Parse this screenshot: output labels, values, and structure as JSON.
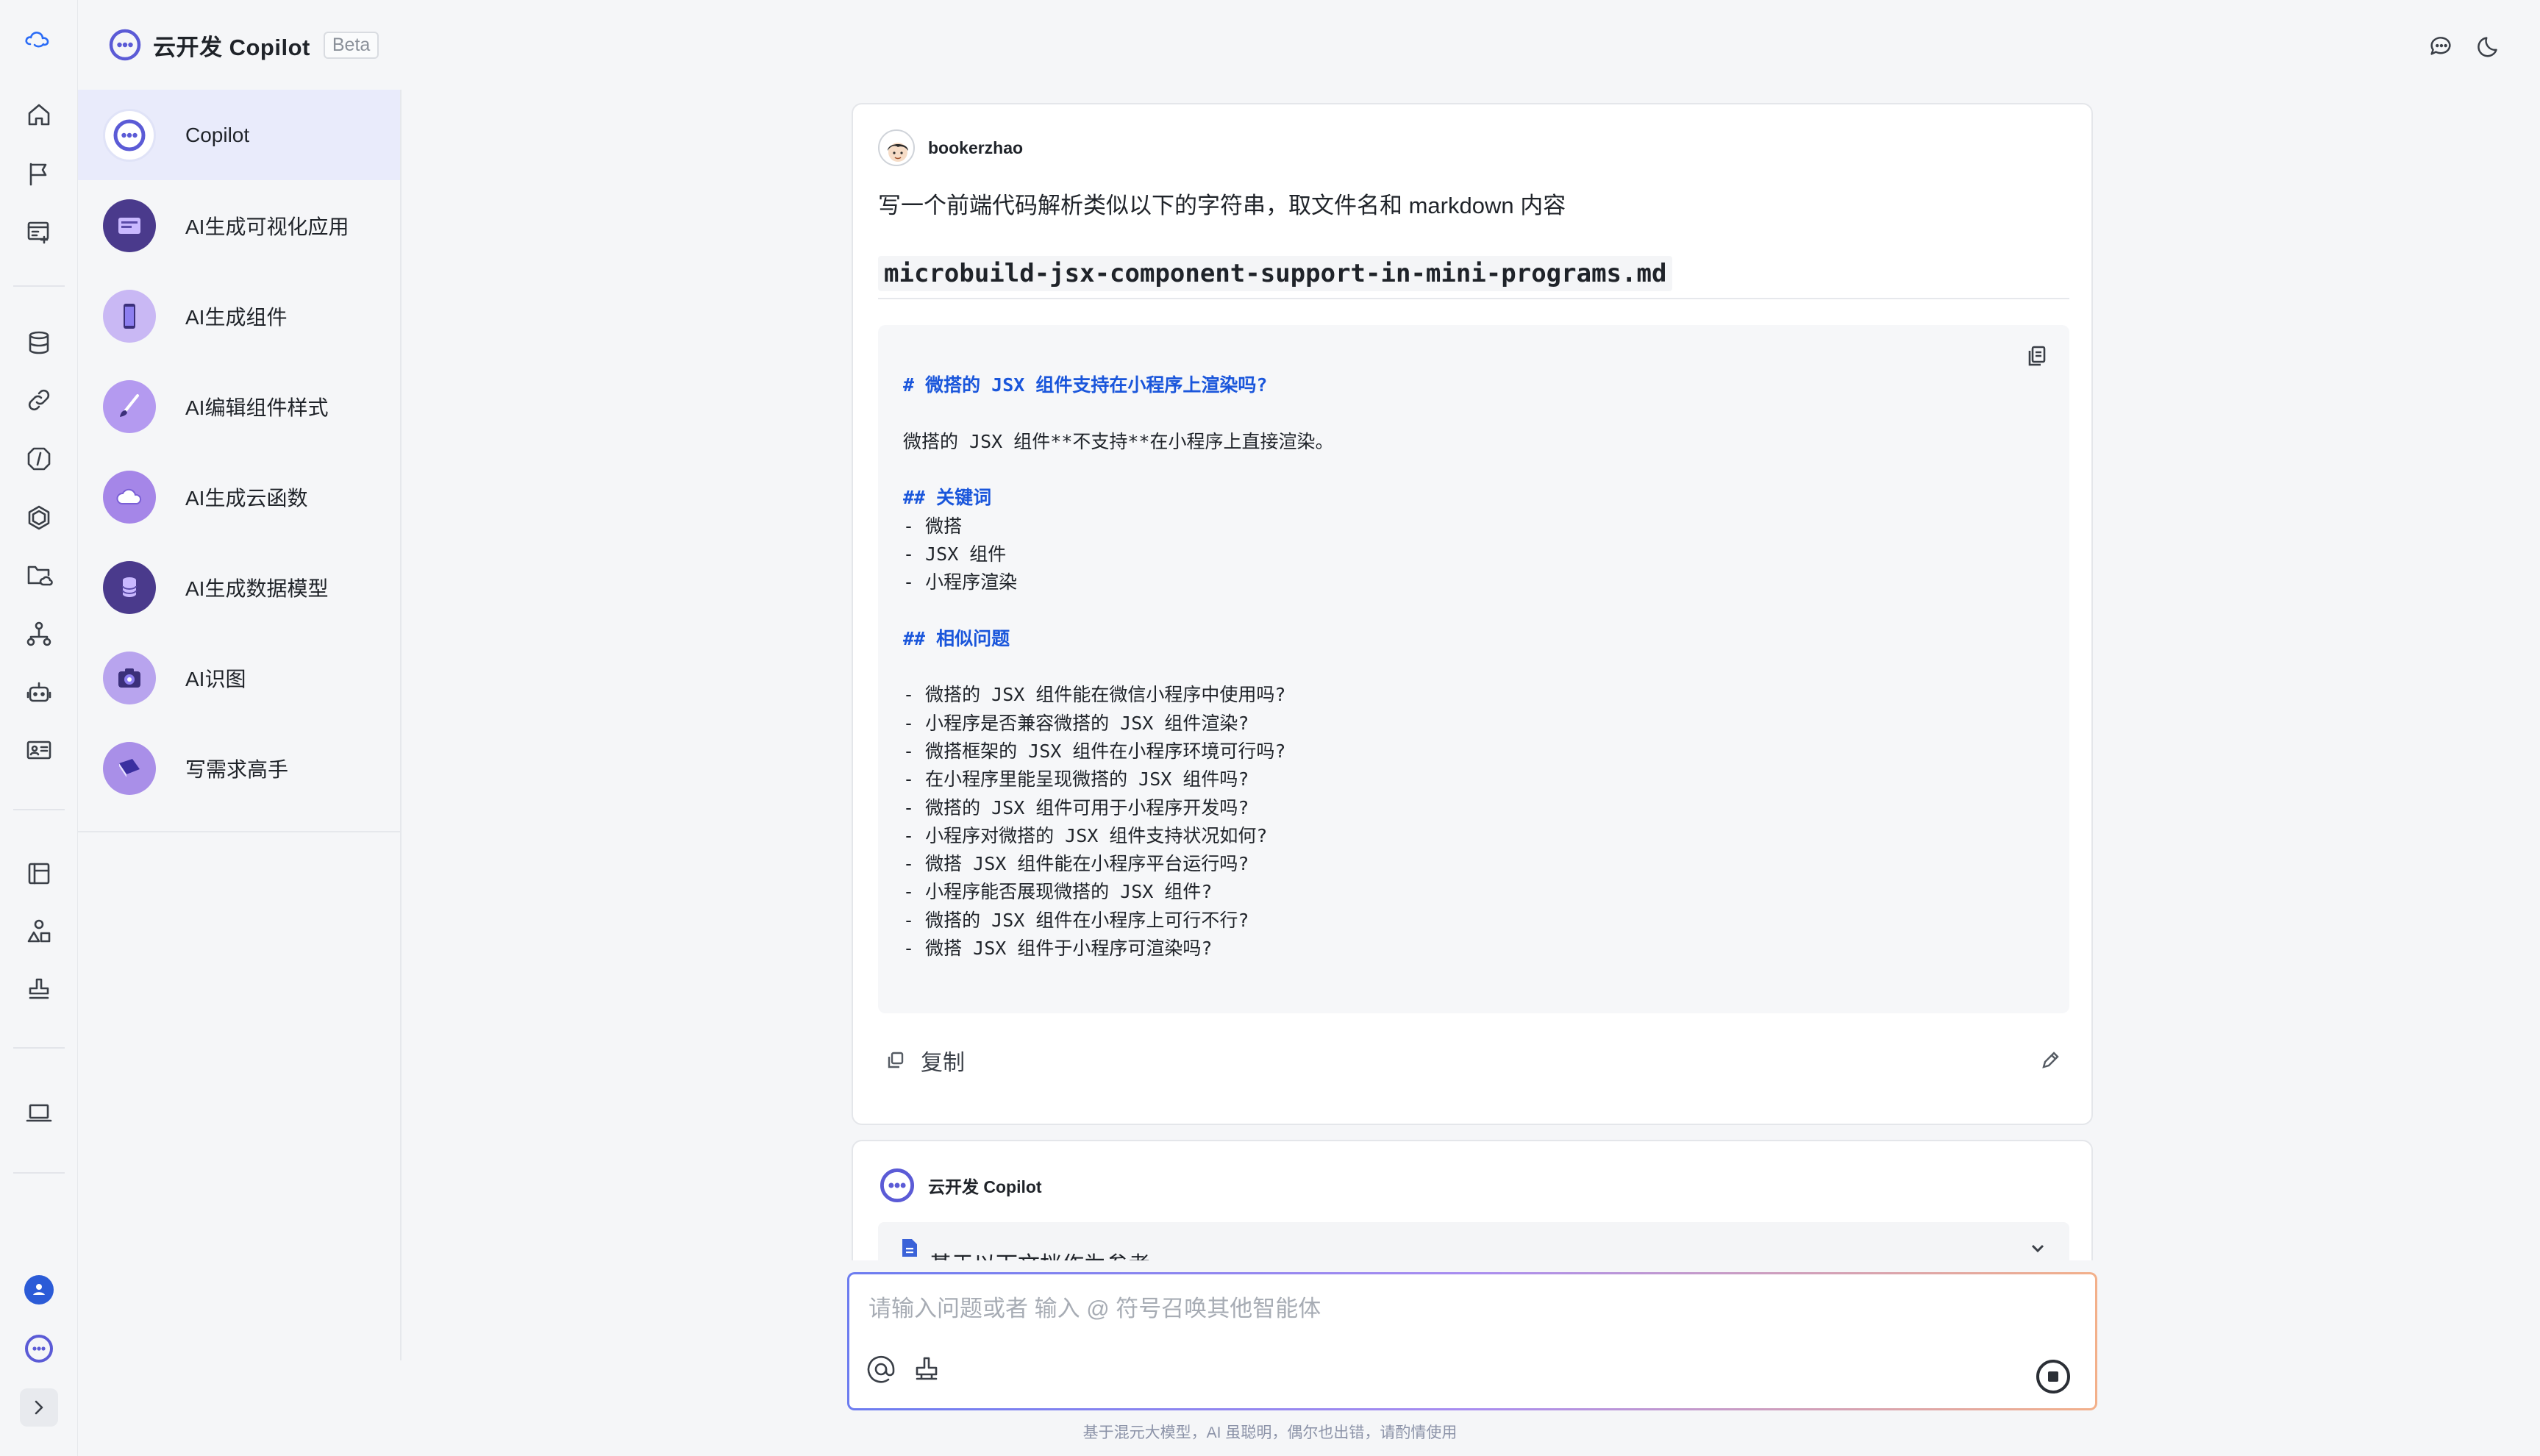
{
  "app": {
    "title": "云开发 Copilot",
    "badge": "Beta"
  },
  "rail": {
    "items": [
      "logo-icon",
      "home-icon",
      "flag-icon",
      "app-screen-icon",
      "database-icon",
      "link-icon",
      "function-icon",
      "hexagon-icon",
      "cloud-folder-icon",
      "hierarchy-icon",
      "robot-icon",
      "id-card-icon",
      "layout-icon",
      "shapes-icon",
      "stamp-icon",
      "laptop-icon",
      "user-avatar-icon",
      "copilot-icon",
      "expand-icon"
    ]
  },
  "header": {
    "right_icons": [
      "chat-icon",
      "moon-icon"
    ]
  },
  "agents": [
    {
      "label": "Copilot",
      "icon": "copilot-icon",
      "active": true
    },
    {
      "label": "AI生成可视化应用",
      "icon": "visual-app-icon"
    },
    {
      "label": "AI生成组件",
      "icon": "phone-icon"
    },
    {
      "label": "AI编辑组件样式",
      "icon": "brush-icon"
    },
    {
      "label": "AI生成云函数",
      "icon": "cloud-icon"
    },
    {
      "label": "AI生成数据模型",
      "icon": "database-icon"
    },
    {
      "label": "AI识图",
      "icon": "camera-icon"
    },
    {
      "label": "写需求高手",
      "icon": "book-icon"
    }
  ],
  "user_message": {
    "username": "bookerzhao",
    "text": "写一个前端代码解析类似以下的字符串，取文件名和 markdown 内容",
    "filename": "microbuild-jsx-component-support-in-mini-programs.md",
    "code_lines": [
      {
        "text": "# 微搭的 JSX 组件支持在小程序上渲染吗?",
        "heading": true
      },
      {
        "text": ""
      },
      {
        "text": "微搭的 JSX 组件**不支持**在小程序上直接渲染。"
      },
      {
        "text": ""
      },
      {
        "text": "## 关键词",
        "heading": true
      },
      {
        "text": "- 微搭"
      },
      {
        "text": "- JSX 组件"
      },
      {
        "text": "- 小程序渲染"
      },
      {
        "text": ""
      },
      {
        "text": "## 相似问题",
        "heading": true
      },
      {
        "text": ""
      },
      {
        "text": "- 微搭的 JSX 组件能在微信小程序中使用吗?"
      },
      {
        "text": "- 小程序是否兼容微搭的 JSX 组件渲染?"
      },
      {
        "text": "- 微搭框架的 JSX 组件在小程序环境可行吗?"
      },
      {
        "text": "- 在小程序里能呈现微搭的 JSX 组件吗?"
      },
      {
        "text": "- 微搭的 JSX 组件可用于小程序开发吗?"
      },
      {
        "text": "- 小程序对微搭的 JSX 组件支持状况如何?"
      },
      {
        "text": "- 微搭 JSX 组件能在小程序平台运行吗?"
      },
      {
        "text": "- 小程序能否展现微搭的 JSX 组件?"
      },
      {
        "text": "- 微搭的 JSX 组件在小程序上可行不行?"
      },
      {
        "text": "- 微搭 JSX 组件于小程序可渲染吗?"
      }
    ],
    "copy_label": "复制"
  },
  "bot_message": {
    "name": "云开发 Copilot",
    "reference_label": "基于以下文档作为参考"
  },
  "composer": {
    "placeholder": "请输入问题或者 输入 @ 符号召唤其他智能体",
    "disclaimer": "基于混元大模型，AI 虽聪明，偶尔也出错，请酌情使用"
  },
  "colors": {
    "accent": "#5b5bd6",
    "active_bg": "#e9ebfb",
    "heading_blue": "#1a56db"
  }
}
